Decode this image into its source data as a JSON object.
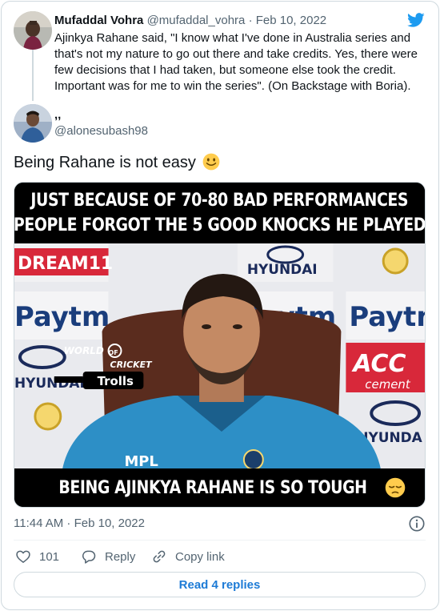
{
  "quoted_tweet": {
    "author_name": "Mufaddal Vohra",
    "author_handle": "@mufaddal_vohra",
    "separator": "·",
    "date": "Feb 10, 2022",
    "text": "Ajinkya Rahane said, \"I know what I've done in Australia series and that's not my nature to go out there and take credits. Yes, there were few decisions that I had taken, but someone else took the credit. Important was for me to win the series\". (On Backstage with Boria)."
  },
  "main_tweet": {
    "author_name": ",,",
    "author_handle": "@alonesubash98",
    "text": "Being Rahane is not easy",
    "emoji": "slightly-smiling-face-icon"
  },
  "media": {
    "caption_top_line1": "JUST BECAUSE OF 70-80 BAD PERFORMANCES",
    "caption_top_line2": "PEOPLE FORGOT THE 5 GOOD KNOCKS HE PLAYED",
    "caption_bottom": "BEING AJINKYA RAHANE IS SO TOUGH",
    "sponsor_dream11": "DREAM11",
    "sponsor_hyundai": "HYUNDAI",
    "sponsor_paytm": "Paytm",
    "sponsor_acc": "ACC",
    "sponsor_cement": "cement",
    "sponsor_hyunda": "HYUNDA",
    "watermark_world": "WORLD",
    "watermark_of": "OF",
    "watermark_cricket": "CRICKET",
    "watermark_trolls": "Trolls",
    "jersey_text": "MPL"
  },
  "footer": {
    "timestamp": "11:44 AM · Feb 10, 2022",
    "like_count": "101",
    "reply_label": "Reply",
    "copy_link_label": "Copy link",
    "read_replies_label": "Read 4 replies"
  },
  "colors": {
    "twitter_blue": "#1d9bf0",
    "link_blue": "#1d7bd6",
    "secondary_text": "#536471",
    "border": "#cfd9de"
  }
}
